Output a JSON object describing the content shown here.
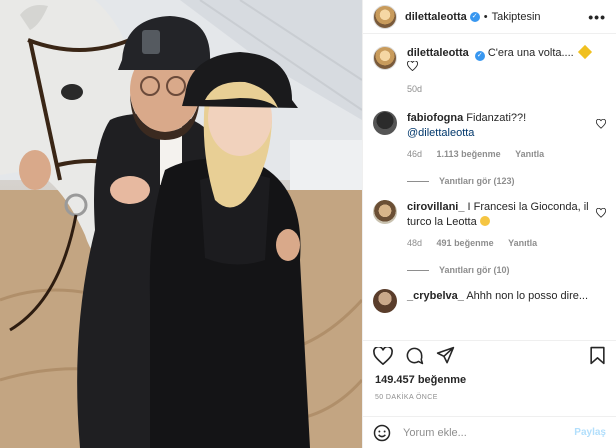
{
  "post": {
    "author": "dilettaleotta",
    "follow_status": "Takiptesin",
    "separator": "•",
    "more": "•••"
  },
  "caption": {
    "username": "dilettaleotta",
    "text": "C'era una volta....",
    "time": "50d"
  },
  "comments": [
    {
      "username": "fabiofogna",
      "text": "Fidanzati??!",
      "mention": "@dilettaleotta",
      "time": "46d",
      "likes": "1.113 beğenme",
      "reply": "Yanıtla",
      "replies": "Yanıtları gör (123)"
    },
    {
      "username": "cirovillani_",
      "text": "I Francesi la Gioconda, il turco la Leotta",
      "time": "48d",
      "likes": "491 beğenme",
      "reply": "Yanıtla",
      "replies": "Yanıtları gör (10)"
    },
    {
      "username": "_crybelva_",
      "text": "Ahhh non lo posso dire..."
    }
  ],
  "footer": {
    "likes": "149.457 beğenme",
    "time": "50 DAKİKA ÖNCE",
    "comment_placeholder": "Yorum ekle...",
    "post_button": "Paylaş"
  },
  "icons": [
    "verified-icon",
    "heart-icon",
    "comment-icon",
    "share-icon",
    "bookmark-icon",
    "emoji-icon",
    "more-icon"
  ],
  "colors": {
    "verified": "#3897f0",
    "link": "#00376b",
    "muted": "#8e8e8e",
    "post_disabled": "#b2dffc"
  }
}
